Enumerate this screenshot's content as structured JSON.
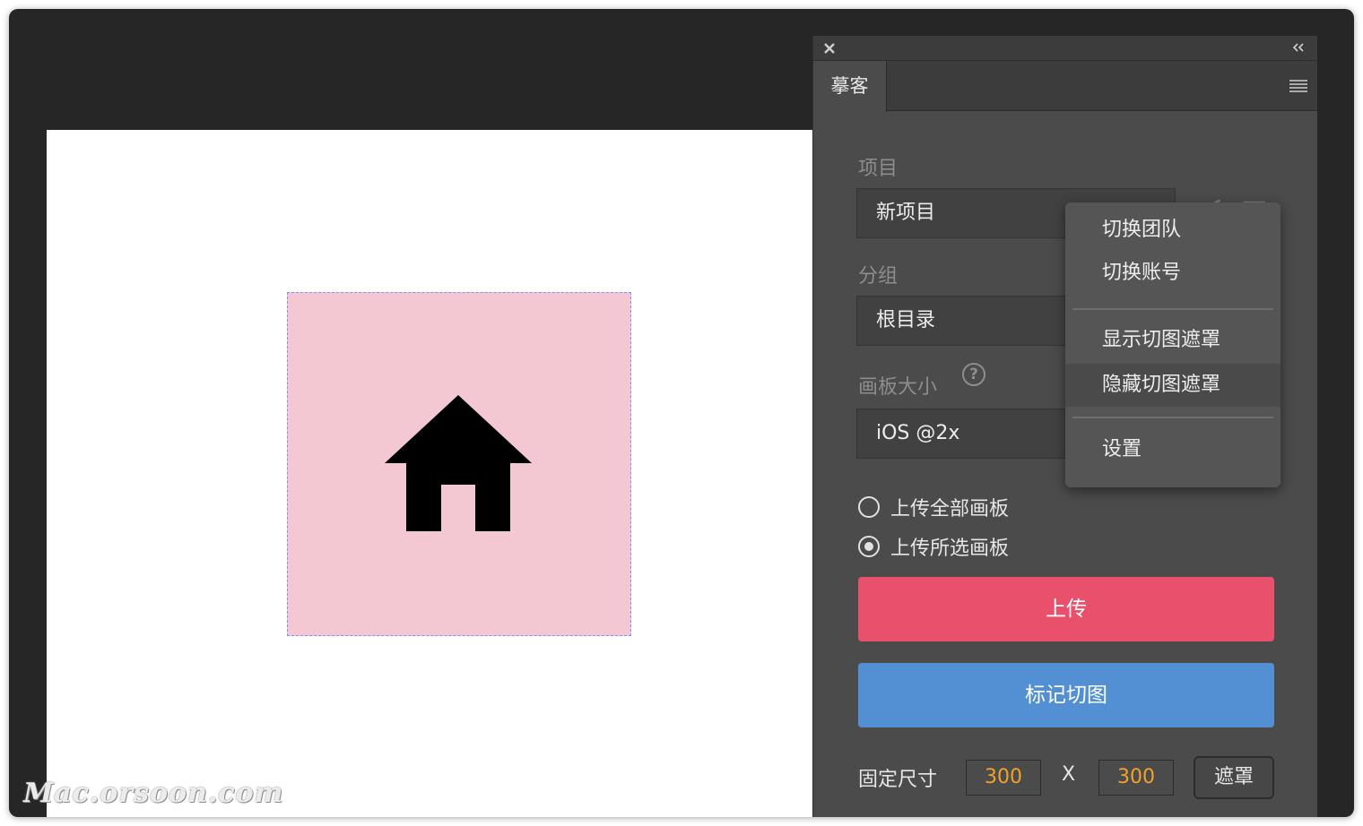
{
  "panel": {
    "tab_label": "摹客",
    "project": {
      "label": "项目",
      "value": "新项目"
    },
    "group": {
      "label": "分组",
      "value": "根目录"
    },
    "artboard_size": {
      "label": "画板大小",
      "help": "?",
      "value": "iOS @2x"
    },
    "radio_options": [
      {
        "label": "上传全部画板",
        "checked": false
      },
      {
        "label": "上传所选画板",
        "checked": true
      }
    ],
    "upload_button": "上传",
    "mark_slice_button": "标记切图",
    "fixed_size": {
      "label": "固定尺寸",
      "width": "300",
      "separator": "X",
      "height": "300",
      "mask_button": "遮罩"
    }
  },
  "dropdown": {
    "items": [
      {
        "label": "切换团队"
      },
      {
        "label": "切换账号"
      },
      {
        "label": "显示切图遮罩"
      },
      {
        "label": "隐藏切图遮罩",
        "highlighted": true
      },
      {
        "label": "设置"
      }
    ]
  },
  "canvas": {
    "artboard_icon": "house-icon",
    "artboard_color": "#f4c8d3"
  },
  "watermark": "Mac.orsoon.com",
  "colors": {
    "upload": "#e8506b",
    "mark": "#528fd3",
    "size_value": "#f0a22c",
    "panel_bg": "#4b4b4b"
  }
}
